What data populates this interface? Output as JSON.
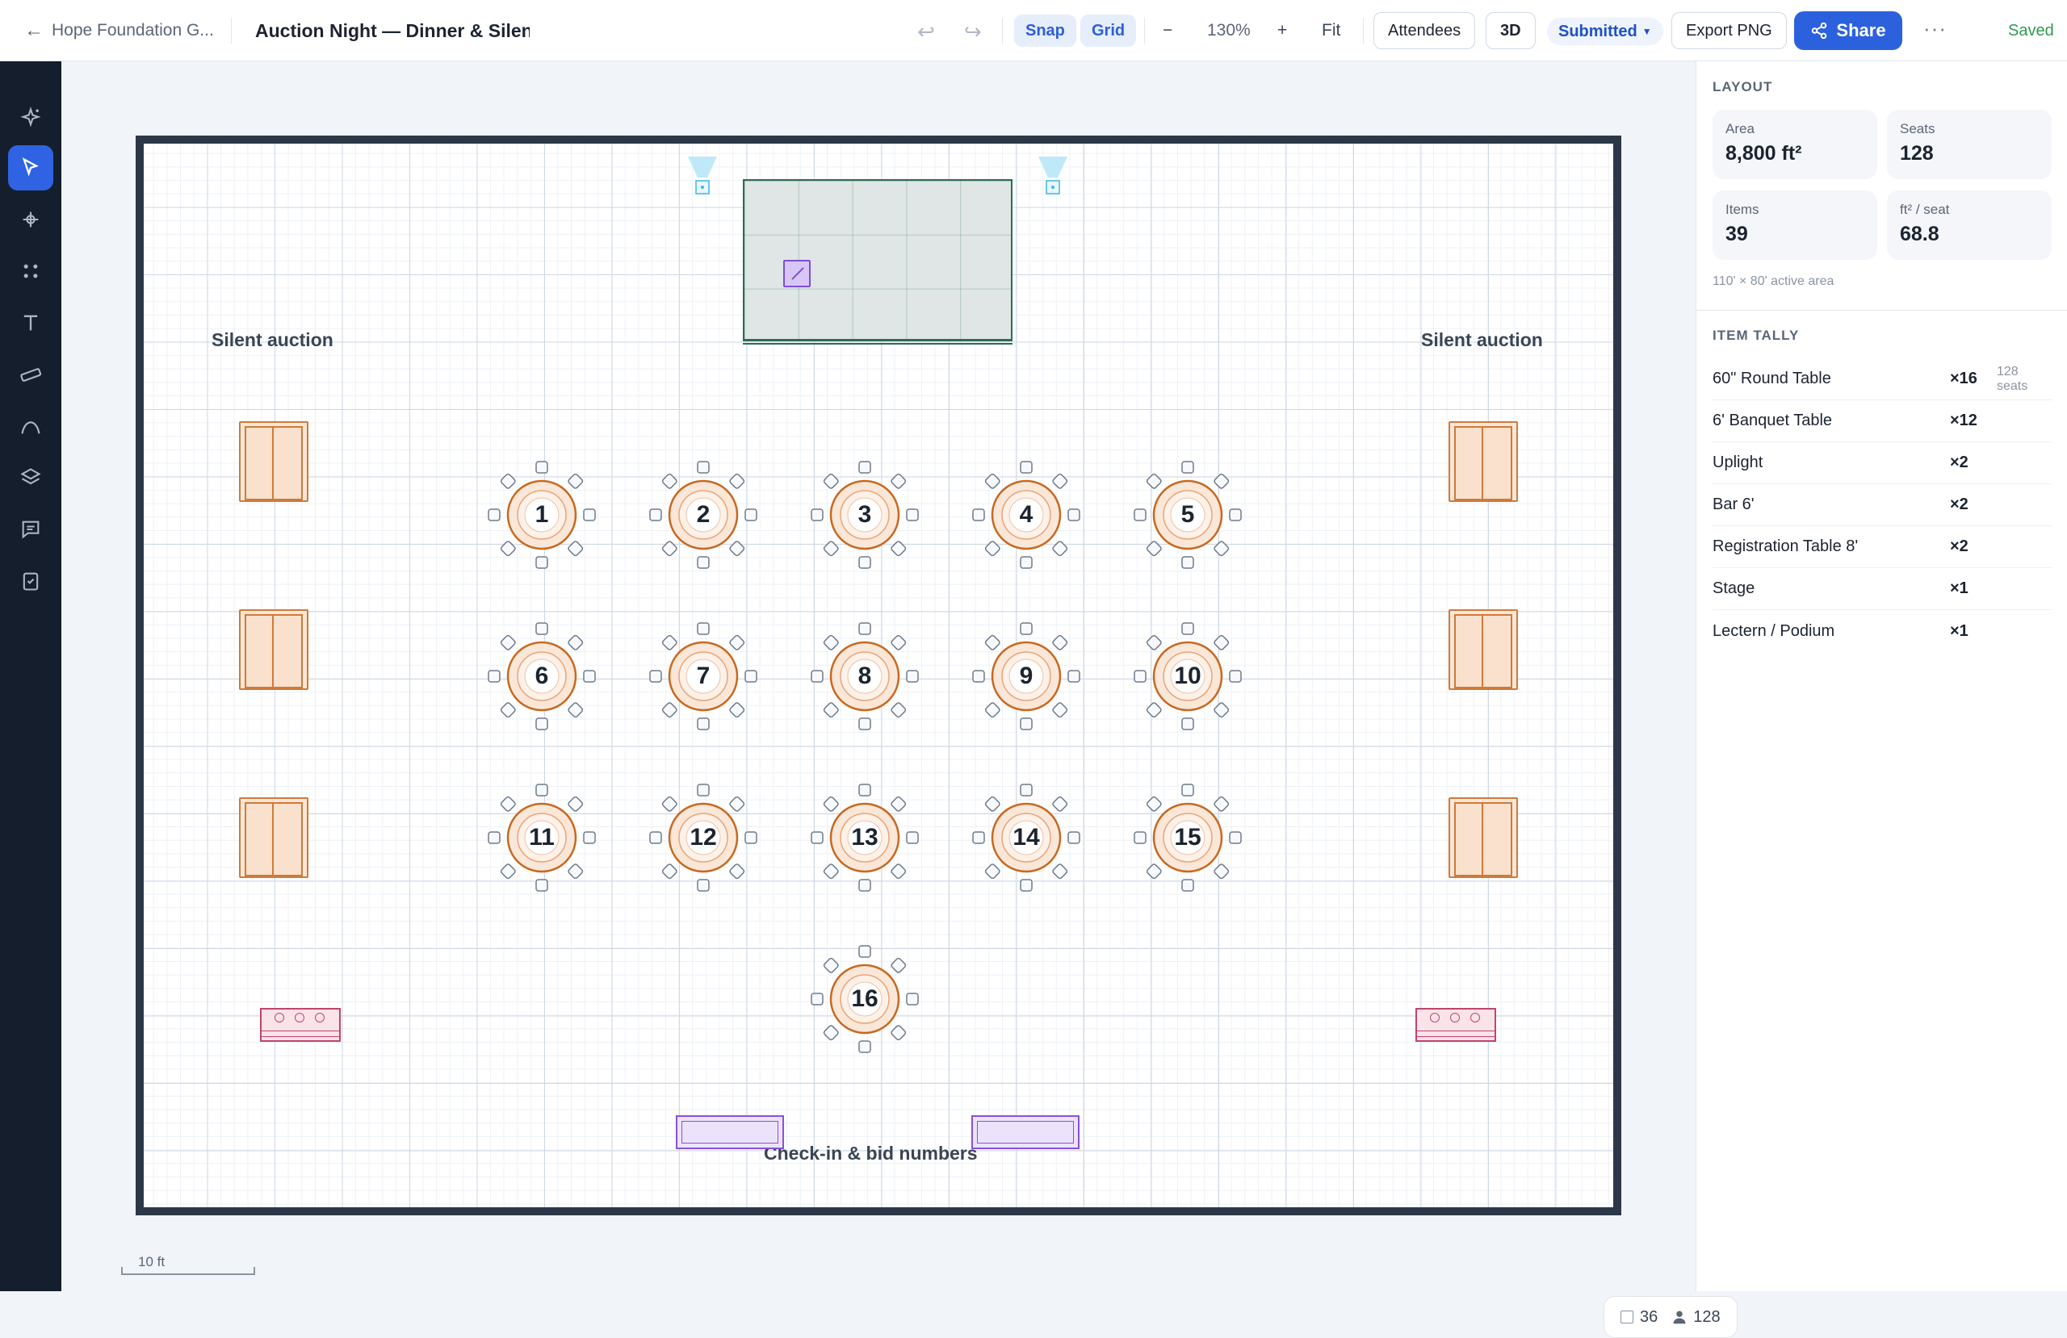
{
  "topbar": {
    "back_label": "Hope Foundation G...",
    "doc_title": "Auction Night — Dinner & Silent Auction",
    "snap_label": "Snap",
    "grid_label": "Grid",
    "zoom_out": "−",
    "zoom_level": "130%",
    "zoom_in": "+",
    "fit_label": "Fit",
    "attendees_label": "Attendees",
    "view3d_label": "3D",
    "status_label": "Submitted",
    "export_label": "Export PNG",
    "share_label": "Share",
    "more_label": "···",
    "saved_label": "Saved"
  },
  "rail": {
    "tools": [
      "sparkle-icon",
      "pointer-icon",
      "shape-icon",
      "grid-dots-icon",
      "text-icon",
      "ruler-icon",
      "curve-icon",
      "layers-icon",
      "comment-icon",
      "checklist-icon"
    ],
    "active": "pointer-icon"
  },
  "canvas": {
    "labels": {
      "silent_auction_left": "Silent auction",
      "silent_auction_right": "Silent auction",
      "checkin": "Check-in & bid numbers"
    },
    "round_tables": [
      "1",
      "2",
      "3",
      "4",
      "5",
      "6",
      "7",
      "8",
      "9",
      "10",
      "11",
      "12",
      "13",
      "14",
      "15",
      "16"
    ],
    "scale_label": "10 ft",
    "count_items": "36",
    "count_people": "128"
  },
  "panel": {
    "layout_title": "LAYOUT",
    "stats": [
      {
        "label": "Area",
        "value": "8,800 ft²"
      },
      {
        "label": "Seats",
        "value": "128"
      },
      {
        "label": "Items",
        "value": "39"
      },
      {
        "label": "ft² / seat",
        "value": "68.8"
      }
    ],
    "active_area": "110' × 80' active area",
    "tally_title": "ITEM TALLY",
    "tally": [
      {
        "name": "60\" Round Table",
        "qty": "×16",
        "note": "128 seats"
      },
      {
        "name": "6' Banquet Table",
        "qty": "×12",
        "note": ""
      },
      {
        "name": "Uplight",
        "qty": "×2",
        "note": ""
      },
      {
        "name": "Bar 6'",
        "qty": "×2",
        "note": ""
      },
      {
        "name": "Registration Table 8'",
        "qty": "×2",
        "note": ""
      },
      {
        "name": "Stage",
        "qty": "×1",
        "note": ""
      },
      {
        "name": "Lectern / Podium",
        "qty": "×1",
        "note": ""
      }
    ]
  },
  "colors": {
    "accent": "#2c61de",
    "table_stroke": "#c8681f",
    "auction_stroke": "#cf7a3a",
    "bar_stroke": "#c0456b",
    "registration_stroke": "#8950dc",
    "stage_stroke": "#2f6b55",
    "uplight": "#3cb7e6",
    "saved": "#2f9a4f"
  }
}
